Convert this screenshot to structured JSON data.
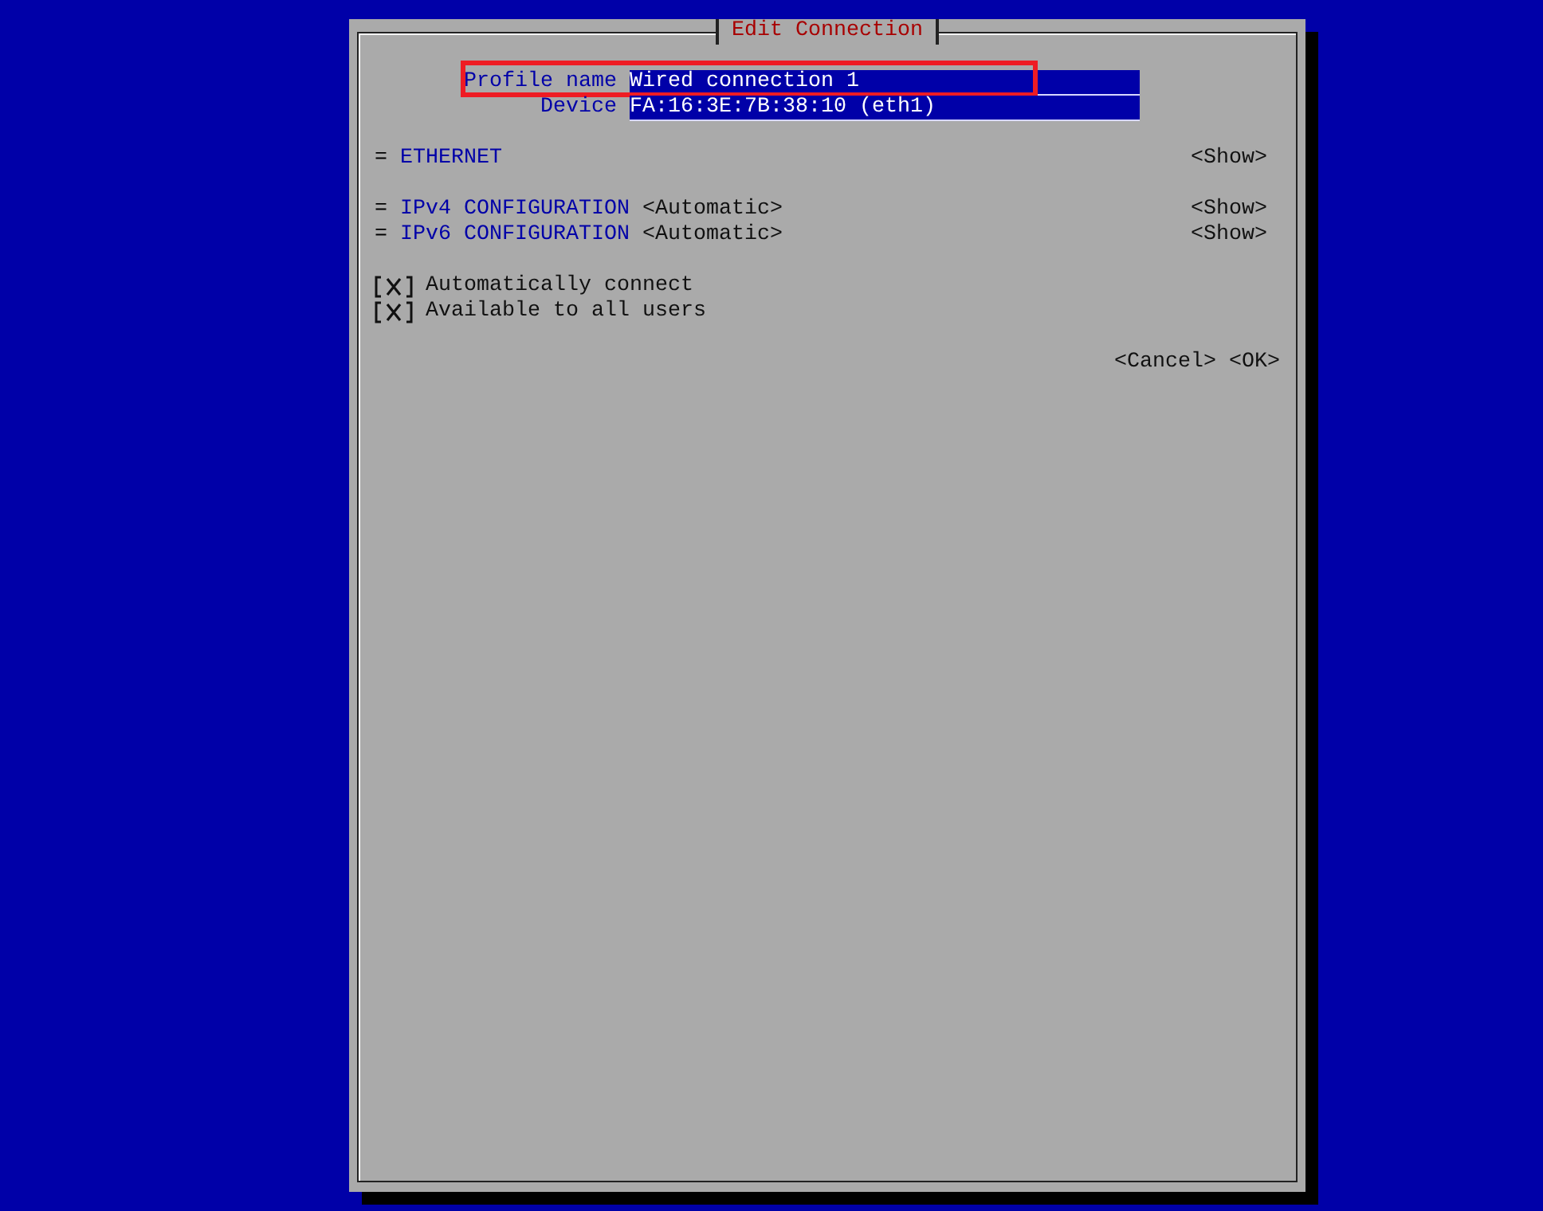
{
  "dialog": {
    "title": "Edit Connection"
  },
  "fields": [
    {
      "label": "Profile name",
      "value": "Wired connection 1",
      "highlighted": true
    },
    {
      "label": "Device",
      "value": "FA:16:3E:7B:38:10 (eth1)",
      "highlighted": false
    }
  ],
  "section_groups": [
    [
      {
        "marker": "=",
        "title": "ETHERNET",
        "button": "<Show>"
      }
    ],
    [
      {
        "marker": "=",
        "title": "IPv4 CONFIGURATION",
        "mode": "<Automatic>",
        "button": "<Show>"
      },
      {
        "marker": "=",
        "title": "IPv6 CONFIGURATION",
        "mode": "<Automatic>",
        "button": "<Show>"
      }
    ]
  ],
  "checkboxes": [
    {
      "label": "Automatically connect",
      "checked": true
    },
    {
      "label": "Available to all users",
      "checked": true
    }
  ],
  "buttons": [
    "<Cancel>",
    "<OK>"
  ]
}
